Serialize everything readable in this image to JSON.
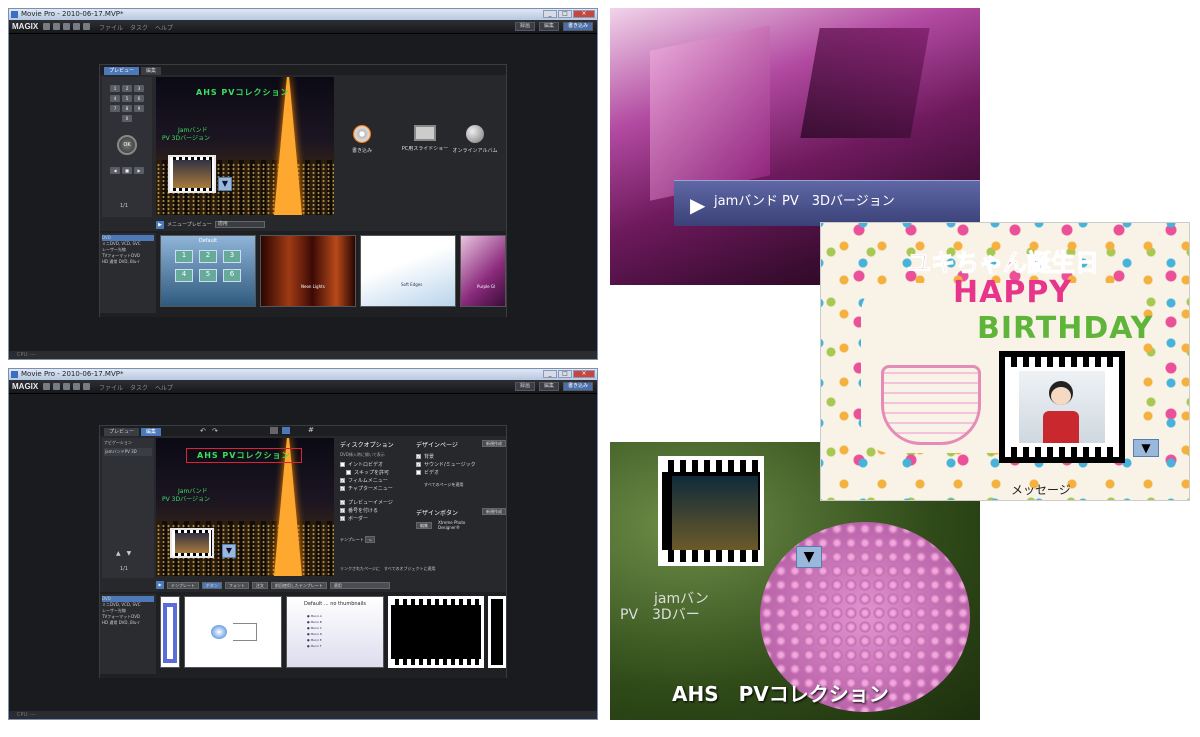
{
  "window1": {
    "title": "Movie Pro - 2010-06-17.MVP*",
    "logo": "MAGIX",
    "menus": [
      "ファイル",
      "タスク",
      "ヘルプ"
    ],
    "modes": [
      "録画",
      "編集",
      "書き込み"
    ],
    "panel_tabs": [
      "プレビュー",
      "編集"
    ],
    "remote_page": "1/1",
    "preview_title": "AHS PVコレクション",
    "preview_sub1": "Jamバンド",
    "preview_sub2": "PV 3Dバージョン",
    "actions": [
      "書き込み",
      "PC用スライドショー",
      "オンラインアルバム"
    ],
    "preview_bar_label": "メニュープレビュー",
    "preview_bar_value": "適用",
    "disc_list": [
      "DVD",
      "ミニDVD, VCD, SVC",
      "レーザー光線",
      "TVフォーマットDVD",
      "HD 通常 DVD, Blu-r"
    ],
    "templates": [
      "Default",
      "Neon Lights",
      "Soft Edges",
      "Purple Gl"
    ],
    "status": "CPU: —"
  },
  "window2": {
    "title": "Movie Pro - 2010-06-17.MVP*",
    "logo": "MAGIX",
    "menus": [
      "ファイル",
      "タスク",
      "ヘルプ"
    ],
    "modes": [
      "録画",
      "編集",
      "書き込み"
    ],
    "panel_tabs": [
      "プレビュー",
      "編集"
    ],
    "nav_header": "ナビゲーション",
    "nav_item": "jamバンドPV 3D",
    "remote_page": "1/1",
    "preview_title": "AHS PVコレクション",
    "preview_sub1": "Jamバンド",
    "preview_sub2": "PV 3Dバージョン",
    "disc_options_header": "ディスクオプション",
    "disc_options_note": "DVD挿入時に開いて表示",
    "disc_options": [
      {
        "label": "イントロビデオ",
        "checked": false
      },
      {
        "label": "スキップを許可",
        "checked": false
      },
      {
        "label": "フィルムメニュー",
        "checked": true
      },
      {
        "label": "チャプターメニュー",
        "checked": true
      },
      {
        "label": "プレビューイメージ",
        "checked": true
      },
      {
        "label": "番号を付ける",
        "checked": true
      },
      {
        "label": "ボーダー",
        "checked": true
      }
    ],
    "apply_template_label": "テンプレート",
    "design_page_header": "デザインページ",
    "new_design_btn": "新規作成",
    "design_page_options": [
      {
        "label": "背景",
        "checked": true
      },
      {
        "label": "サウンド/ミュージック",
        "checked": true
      },
      {
        "label": "ビデオ",
        "checked": false
      }
    ],
    "apply_all_pages": "すべてのページを適用",
    "design_button_header": "デザインボタン",
    "edit_btn": "編集",
    "xtreme_label": "Xtreme Photo Designer®",
    "link_note": "リンクされたページに",
    "apply_all_objects": "すべてのオブジェクトに適用",
    "bottom_tabs": [
      "テンプレート",
      "ボタン",
      "フォント",
      "注文"
    ],
    "recent_templates": "前回使用したテンプレート",
    "recent_value": "適用",
    "disc_list": [
      "DVD",
      "ミニDVD, VCD, SVC",
      "レーザー光線",
      "TVフォーマットDVD",
      "HD 通常 DVD, Blu-r"
    ],
    "default_template": "Default ... no thumbnails",
    "status": "CPU: —"
  },
  "sample_top": {
    "menu_item": "jamバンド PV　3Dバージョン"
  },
  "sample_birthday": {
    "title": "ユキちゃん誕生日",
    "line1": "HAPPY",
    "line2": "BIRTHDAY",
    "caption": "メッセージ"
  },
  "sample_flower": {
    "sub": "jamバン",
    "sub2": "PV　3Dバー",
    "title": "AHS　PVコレクション"
  },
  "colors": {
    "accent": "#4d79b8",
    "green_title": "#3be060",
    "pink": "#d7509a"
  }
}
